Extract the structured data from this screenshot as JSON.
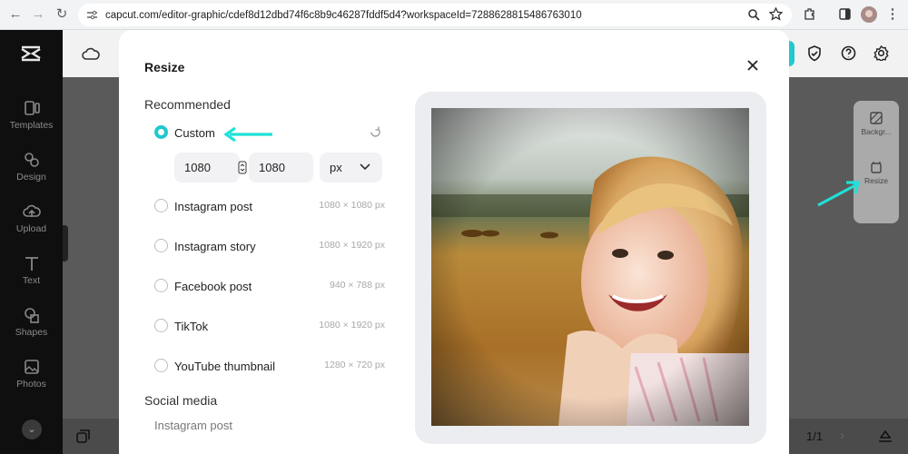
{
  "browser": {
    "url": "capcut.com/editor-graphic/cdef8d12dbd74f6c8b9c46287fddf5d4?workspaceId=7288628815486763010"
  },
  "sidebar": {
    "items": [
      {
        "label": "Templates",
        "icon": "templates-icon"
      },
      {
        "label": "Design",
        "icon": "design-icon"
      },
      {
        "label": "Upload",
        "icon": "upload-icon"
      },
      {
        "label": "Text",
        "icon": "text-icon"
      },
      {
        "label": "Shapes",
        "icon": "shapes-icon"
      },
      {
        "label": "Photos",
        "icon": "photos-icon"
      }
    ]
  },
  "right_panel": {
    "background_label": "Backgr...",
    "resize_label": "Resize"
  },
  "bottom": {
    "page_counter": "1/1"
  },
  "modal": {
    "title": "Resize",
    "recommended_heading": "Recommended",
    "custom_label": "Custom",
    "width_value": "1080",
    "height_value": "1080",
    "unit": "px",
    "presets": [
      {
        "label": "Instagram post",
        "size": "1080 × 1080 px"
      },
      {
        "label": "Instagram story",
        "size": "1080 × 1920 px"
      },
      {
        "label": "Facebook post",
        "size": "940 × 788 px"
      },
      {
        "label": "TikTok",
        "size": "1080 × 1920 px"
      },
      {
        "label": "YouTube thumbnail",
        "size": "1280 × 720 px"
      }
    ],
    "social_heading": "Social media",
    "social_first": "Instagram post"
  },
  "colors": {
    "accent": "#21c8cf",
    "annotation_arrow": "#20e0d8"
  }
}
